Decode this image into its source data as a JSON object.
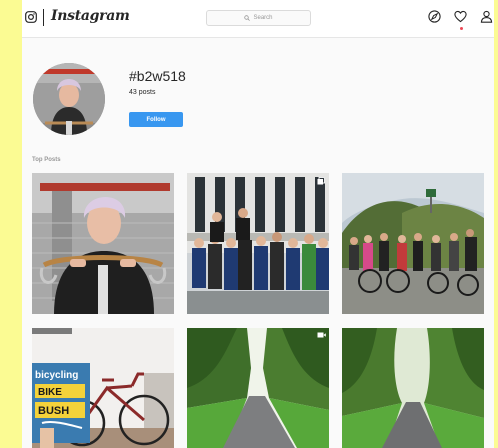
{
  "app": {
    "name": "Instagram"
  },
  "search": {
    "placeholder": "Search"
  },
  "profile": {
    "hashtag": "#b2w518",
    "posts_count": "43 posts",
    "follow_label": "Follow"
  },
  "sections": {
    "top_posts": "Top Posts"
  },
  "book": {
    "line1": "bicycling",
    "line2": "BIKE",
    "line3": "BUSH"
  },
  "icons": {
    "camera": "camera-icon",
    "search": "search-icon",
    "explore": "compass-icon",
    "activity": "heart-icon",
    "profile": "person-icon",
    "multi": "carousel-icon",
    "video": "video-icon"
  },
  "colors": {
    "follow": "#3897f0",
    "notification": "#ed4956",
    "background": "#fbfb93"
  }
}
